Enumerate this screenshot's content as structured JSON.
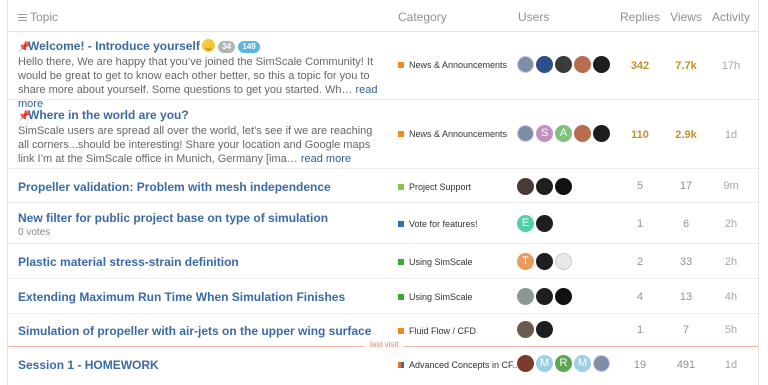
{
  "columns": {
    "topic": "Topic",
    "category": "Category",
    "users": "Users",
    "replies": "Replies",
    "views": "Views",
    "activity": "Activity"
  },
  "last_visit_label": "last visit",
  "colors": {
    "title_link": "#3a6aa6",
    "hot_number": "#c48f29",
    "last_visit_line": "#f2b5a3"
  },
  "topics": [
    {
      "title": "Welcome! - Introduce yourself",
      "pinned": true,
      "emoji": "smile-emoji",
      "badges": [
        "34",
        "149"
      ],
      "excerpt": "Hello there, We are happy that you’ve joined the SimScale Community! It would be great to get to know each other better, so this a topic for you to share more about yourself. Some questions to get you started. Wh…",
      "read_more": "read more",
      "category": "News & Announcements",
      "category_color": "#f0891e",
      "users": [
        "avatar-photo",
        "avatar-photo",
        "avatar-photo",
        "avatar-photo",
        "avatar-photo"
      ],
      "replies": "342",
      "views": "7.7k",
      "activity": "17h"
    },
    {
      "title": "Where in the world are you?",
      "pinned": true,
      "excerpt": "SimScale users are spread all over the world, let’s see if we are reaching all corners...should be interesting! Share your location and Google maps link I’m at the SimScale office in Munich, Germany [ima…",
      "read_more": "read more",
      "category": "News & Announcements",
      "category_color": "#f0891e",
      "users": [
        "avatar-photo",
        "S",
        "A",
        "avatar-photo",
        "avatar-photo"
      ],
      "replies": "110",
      "views": "2.9k",
      "activity": "1d"
    },
    {
      "title": "Propeller validation: Problem with mesh independence",
      "category": "Project Support",
      "category_color": "#8cc63f",
      "users": [
        "avatar-photo",
        "avatar-photo",
        "avatar-photo"
      ],
      "replies": "5",
      "views": "17",
      "activity": "9m"
    },
    {
      "title": "New filter for public project base on type of simulation",
      "votes": "0 votes",
      "category": "Vote for features!",
      "category_color": "#2f6fb3",
      "users": [
        "E",
        "avatar-photo"
      ],
      "replies": "1",
      "views": "6",
      "activity": "2h"
    },
    {
      "title": "Plastic material stress-strain definition",
      "category": "Using SimScale",
      "category_color": "#3aaa35",
      "users": [
        "T",
        "avatar-photo",
        "avatar-photo"
      ],
      "replies": "2",
      "views": "33",
      "activity": "2h"
    },
    {
      "title": "Extending Maximum Run Time When Simulation Finishes",
      "category": "Using SimScale",
      "category_color": "#3aaa35",
      "users": [
        "avatar-photo",
        "avatar-photo",
        "avatar-photo"
      ],
      "replies": "4",
      "views": "13",
      "activity": "4h"
    },
    {
      "title": "Simulation of propeller with air-jets on the upper wing surface",
      "category": "Fluid Flow / CFD",
      "category_color": "#f0891e",
      "users": [
        "avatar-photo",
        "avatar-photo"
      ],
      "replies": "1",
      "views": "7",
      "activity": "5h"
    },
    {
      "title": "Session 1 - HOMEWORK",
      "category": "Advanced Concepts in CF...",
      "category_color": "#e8702a",
      "users": [
        "avatar-photo",
        "M",
        "R",
        "M",
        "avatar-photo"
      ],
      "replies": "19",
      "views": "491",
      "activity": "1d"
    }
  ]
}
